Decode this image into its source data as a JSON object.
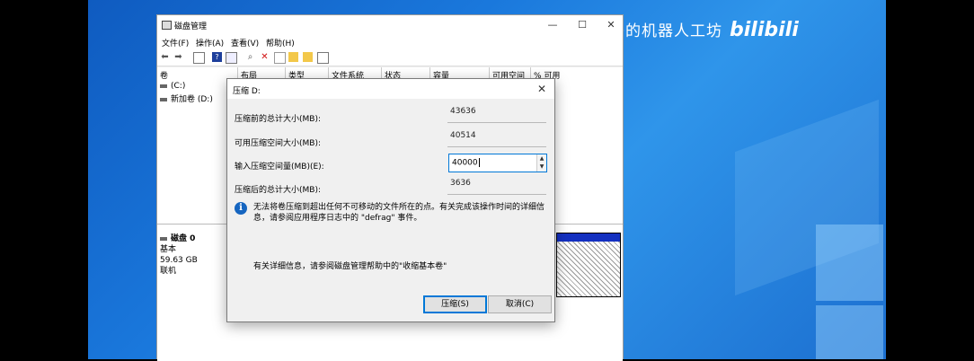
{
  "watermark": {
    "text": "杰哥的机器人工坊",
    "logo": "bilibili"
  },
  "window": {
    "title": "磁盘管理",
    "controls": {
      "minimize": "—",
      "maximize": "☐",
      "close": "✕"
    },
    "menu": [
      "文件(F)",
      "操作(A)",
      "查看(V)",
      "帮助(H)"
    ],
    "columns": [
      "卷",
      "布局",
      "类型",
      "文件系统",
      "状态",
      "容量",
      "可用空间",
      "% 可用"
    ],
    "volumes": [
      "(C:)",
      "新加卷 (D:)"
    ],
    "disk": {
      "name": "磁盘 0",
      "type": "基本",
      "size": "59.63 GB",
      "status": "联机"
    }
  },
  "dialog": {
    "title": "压缩 D:",
    "close": "✕",
    "fields": [
      {
        "label": "压缩前的总计大小(MB):",
        "value": "43636"
      },
      {
        "label": "可用压缩空间大小(MB):",
        "value": "40514"
      },
      {
        "label": "输入压缩空间量(MB)(E):",
        "value": "40000"
      },
      {
        "label": "压缩后的总计大小(MB):",
        "value": "3636"
      }
    ],
    "info_icon": "info-icon",
    "info_text": "无法将卷压缩到超出任何不可移动的文件所在的点。有关完成该操作时间的详细信息，请参阅应用程序日志中的 \"defrag\" 事件。",
    "more_info": "有关详细信息，请参阅磁盘管理帮助中的\"收缩基本卷\"",
    "buttons": {
      "ok": "压缩(S)",
      "cancel": "取消(C)"
    }
  }
}
